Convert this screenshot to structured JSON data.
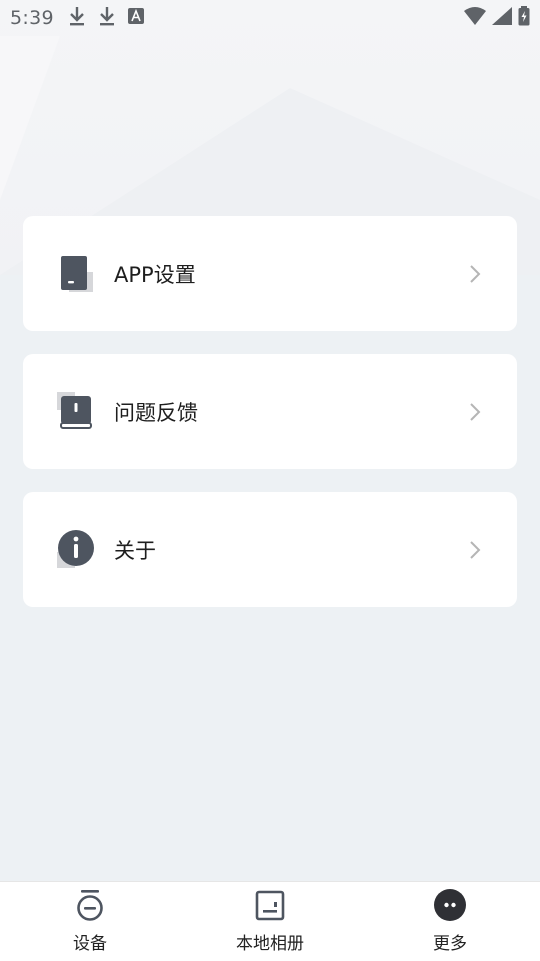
{
  "status_bar": {
    "time": "5:39",
    "left_icons": [
      "download-icon",
      "download-icon",
      "font-a-icon"
    ],
    "right_icons": [
      "wifi-icon",
      "signal-icon",
      "battery-icon"
    ]
  },
  "menu": {
    "items": [
      {
        "label": "APP设置",
        "icon": "settings-device-icon"
      },
      {
        "label": "问题反馈",
        "icon": "feedback-book-icon"
      },
      {
        "label": "关于",
        "icon": "info-icon"
      }
    ]
  },
  "tabbar": {
    "tabs": [
      {
        "label": "设备",
        "icon": "device-icon",
        "active": false
      },
      {
        "label": "本地相册",
        "icon": "album-icon",
        "active": false
      },
      {
        "label": "更多",
        "icon": "more-icon",
        "active": true
      }
    ]
  },
  "colors": {
    "background": "#edf1f4",
    "card": "#ffffff",
    "icon_dark": "#4e5560",
    "text": "#1e1e1e",
    "chevron": "#b5b5b5"
  }
}
